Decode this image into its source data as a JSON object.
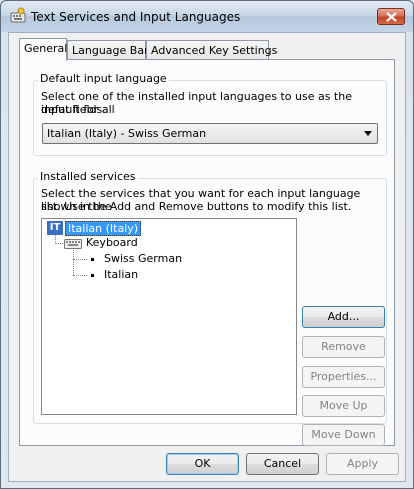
{
  "window": {
    "title": "Text Services and Input Languages"
  },
  "tabs": [
    {
      "label": "General"
    },
    {
      "label": "Language Bar"
    },
    {
      "label": "Advanced Key Settings"
    }
  ],
  "default_input": {
    "group_label": "Default input language",
    "description_line1": "Select one of the installed input languages to use as the default for all",
    "description_line2": "input fields.",
    "selected_value": "Italian (Italy) - Swiss German"
  },
  "installed_services": {
    "group_label": "Installed services",
    "description_line1": "Select the services that you want for each input language shown in the",
    "description_line2": "list. Use the Add and Remove buttons to modify this list.",
    "tree": {
      "language_badge": "IT",
      "language": "Italian (Italy)",
      "category": "Keyboard",
      "layouts": [
        "Swiss German",
        "Italian"
      ]
    },
    "buttons": {
      "add": "Add...",
      "remove": "Remove",
      "properties": "Properties...",
      "move_up": "Move Up",
      "move_down": "Move Down"
    }
  },
  "footer": {
    "ok": "OK",
    "cancel": "Cancel",
    "apply": "Apply"
  }
}
